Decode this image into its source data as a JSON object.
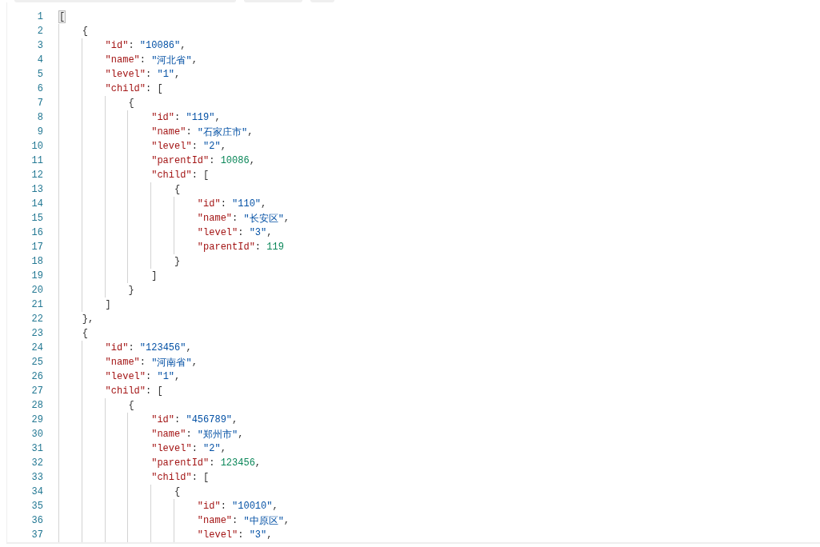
{
  "editor": {
    "lines": [
      {
        "number": "1",
        "code": [
          {
            "kind": "bracket",
            "text": "[",
            "matched": true
          }
        ]
      },
      {
        "number": "2",
        "code": [
          {
            "kind": "bracket",
            "text": "    {",
            "matched": false
          }
        ]
      },
      {
        "number": "3",
        "code": [
          {
            "kind": "key",
            "text": "        \"id\""
          },
          {
            "kind": "punct",
            "text": ": "
          },
          {
            "kind": "string",
            "text": "\"10086\""
          },
          {
            "kind": "punct",
            "text": ","
          }
        ]
      },
      {
        "number": "4",
        "code": [
          {
            "kind": "key",
            "text": "        \"name\""
          },
          {
            "kind": "punct",
            "text": ": "
          },
          {
            "kind": "string",
            "text": "\"河北省\""
          },
          {
            "kind": "punct",
            "text": ","
          }
        ]
      },
      {
        "number": "5",
        "code": [
          {
            "kind": "key",
            "text": "        \"level\""
          },
          {
            "kind": "punct",
            "text": ": "
          },
          {
            "kind": "string",
            "text": "\"1\""
          },
          {
            "kind": "punct",
            "text": ","
          }
        ]
      },
      {
        "number": "6",
        "code": [
          {
            "kind": "key",
            "text": "        \"child\""
          },
          {
            "kind": "punct",
            "text": ": "
          },
          {
            "kind": "bracket",
            "text": "[",
            "matched": false
          }
        ]
      },
      {
        "number": "7",
        "code": [
          {
            "kind": "bracket",
            "text": "            {",
            "matched": false
          }
        ]
      },
      {
        "number": "8",
        "code": [
          {
            "kind": "key",
            "text": "                \"id\""
          },
          {
            "kind": "punct",
            "text": ": "
          },
          {
            "kind": "string",
            "text": "\"119\""
          },
          {
            "kind": "punct",
            "text": ","
          }
        ]
      },
      {
        "number": "9",
        "code": [
          {
            "kind": "key",
            "text": "                \"name\""
          },
          {
            "kind": "punct",
            "text": ": "
          },
          {
            "kind": "string",
            "text": "\"石家庄市\""
          },
          {
            "kind": "punct",
            "text": ","
          }
        ]
      },
      {
        "number": "10",
        "code": [
          {
            "kind": "key",
            "text": "                \"level\""
          },
          {
            "kind": "punct",
            "text": ": "
          },
          {
            "kind": "string",
            "text": "\"2\""
          },
          {
            "kind": "punct",
            "text": ","
          }
        ]
      },
      {
        "number": "11",
        "code": [
          {
            "kind": "key",
            "text": "                \"parentId\""
          },
          {
            "kind": "punct",
            "text": ": "
          },
          {
            "kind": "number",
            "text": "10086"
          },
          {
            "kind": "punct",
            "text": ","
          }
        ]
      },
      {
        "number": "12",
        "code": [
          {
            "kind": "key",
            "text": "                \"child\""
          },
          {
            "kind": "punct",
            "text": ": "
          },
          {
            "kind": "bracket",
            "text": "[",
            "matched": false
          }
        ]
      },
      {
        "number": "13",
        "code": [
          {
            "kind": "bracket",
            "text": "                    {",
            "matched": false
          }
        ]
      },
      {
        "number": "14",
        "code": [
          {
            "kind": "key",
            "text": "                        \"id\""
          },
          {
            "kind": "punct",
            "text": ": "
          },
          {
            "kind": "string",
            "text": "\"110\""
          },
          {
            "kind": "punct",
            "text": ","
          }
        ]
      },
      {
        "number": "15",
        "code": [
          {
            "kind": "key",
            "text": "                        \"name\""
          },
          {
            "kind": "punct",
            "text": ": "
          },
          {
            "kind": "string",
            "text": "\"长安区\""
          },
          {
            "kind": "punct",
            "text": ","
          }
        ]
      },
      {
        "number": "16",
        "code": [
          {
            "kind": "key",
            "text": "                        \"level\""
          },
          {
            "kind": "punct",
            "text": ": "
          },
          {
            "kind": "string",
            "text": "\"3\""
          },
          {
            "kind": "punct",
            "text": ","
          }
        ]
      },
      {
        "number": "17",
        "code": [
          {
            "kind": "key",
            "text": "                        \"parentId\""
          },
          {
            "kind": "punct",
            "text": ": "
          },
          {
            "kind": "number",
            "text": "119"
          }
        ]
      },
      {
        "number": "18",
        "code": [
          {
            "kind": "bracket",
            "text": "                    }",
            "matched": false
          }
        ]
      },
      {
        "number": "19",
        "code": [
          {
            "kind": "bracket",
            "text": "                ]",
            "matched": false
          }
        ]
      },
      {
        "number": "20",
        "code": [
          {
            "kind": "bracket",
            "text": "            }",
            "matched": false
          }
        ]
      },
      {
        "number": "21",
        "code": [
          {
            "kind": "bracket",
            "text": "        ]",
            "matched": false
          }
        ]
      },
      {
        "number": "22",
        "code": [
          {
            "kind": "bracket",
            "text": "    }",
            "matched": false
          },
          {
            "kind": "punct",
            "text": ","
          }
        ]
      },
      {
        "number": "23",
        "code": [
          {
            "kind": "bracket",
            "text": "    {",
            "matched": false
          }
        ]
      },
      {
        "number": "24",
        "code": [
          {
            "kind": "key",
            "text": "        \"id\""
          },
          {
            "kind": "punct",
            "text": ": "
          },
          {
            "kind": "string",
            "text": "\"123456\""
          },
          {
            "kind": "punct",
            "text": ","
          }
        ]
      },
      {
        "number": "25",
        "code": [
          {
            "kind": "key",
            "text": "        \"name\""
          },
          {
            "kind": "punct",
            "text": ": "
          },
          {
            "kind": "string",
            "text": "\"河南省\""
          },
          {
            "kind": "punct",
            "text": ","
          }
        ]
      },
      {
        "number": "26",
        "code": [
          {
            "kind": "key",
            "text": "        \"level\""
          },
          {
            "kind": "punct",
            "text": ": "
          },
          {
            "kind": "string",
            "text": "\"1\""
          },
          {
            "kind": "punct",
            "text": ","
          }
        ]
      },
      {
        "number": "27",
        "code": [
          {
            "kind": "key",
            "text": "        \"child\""
          },
          {
            "kind": "punct",
            "text": ": "
          },
          {
            "kind": "bracket",
            "text": "[",
            "matched": false
          }
        ]
      },
      {
        "number": "28",
        "code": [
          {
            "kind": "bracket",
            "text": "            {",
            "matched": false
          }
        ]
      },
      {
        "number": "29",
        "code": [
          {
            "kind": "key",
            "text": "                \"id\""
          },
          {
            "kind": "punct",
            "text": ": "
          },
          {
            "kind": "string",
            "text": "\"456789\""
          },
          {
            "kind": "punct",
            "text": ","
          }
        ]
      },
      {
        "number": "30",
        "code": [
          {
            "kind": "key",
            "text": "                \"name\""
          },
          {
            "kind": "punct",
            "text": ": "
          },
          {
            "kind": "string",
            "text": "\"郑州市\""
          },
          {
            "kind": "punct",
            "text": ","
          }
        ]
      },
      {
        "number": "31",
        "code": [
          {
            "kind": "key",
            "text": "                \"level\""
          },
          {
            "kind": "punct",
            "text": ": "
          },
          {
            "kind": "string",
            "text": "\"2\""
          },
          {
            "kind": "punct",
            "text": ","
          }
        ]
      },
      {
        "number": "32",
        "code": [
          {
            "kind": "key",
            "text": "                \"parentId\""
          },
          {
            "kind": "punct",
            "text": ": "
          },
          {
            "kind": "number",
            "text": "123456"
          },
          {
            "kind": "punct",
            "text": ","
          }
        ]
      },
      {
        "number": "33",
        "code": [
          {
            "kind": "key",
            "text": "                \"child\""
          },
          {
            "kind": "punct",
            "text": ": "
          },
          {
            "kind": "bracket",
            "text": "[",
            "matched": false
          }
        ]
      },
      {
        "number": "34",
        "code": [
          {
            "kind": "bracket",
            "text": "                    {",
            "matched": false
          }
        ]
      },
      {
        "number": "35",
        "code": [
          {
            "kind": "key",
            "text": "                        \"id\""
          },
          {
            "kind": "punct",
            "text": ": "
          },
          {
            "kind": "string",
            "text": "\"10010\""
          },
          {
            "kind": "punct",
            "text": ","
          }
        ]
      },
      {
        "number": "36",
        "code": [
          {
            "kind": "key",
            "text": "                        \"name\""
          },
          {
            "kind": "punct",
            "text": ": "
          },
          {
            "kind": "string",
            "text": "\"中原区\""
          },
          {
            "kind": "punct",
            "text": ","
          }
        ]
      },
      {
        "number": "37",
        "code": [
          {
            "kind": "key",
            "text": "                        \"level\""
          },
          {
            "kind": "punct",
            "text": ": "
          },
          {
            "kind": "string",
            "text": "\"3\""
          },
          {
            "kind": "punct",
            "text": ","
          }
        ]
      }
    ]
  }
}
